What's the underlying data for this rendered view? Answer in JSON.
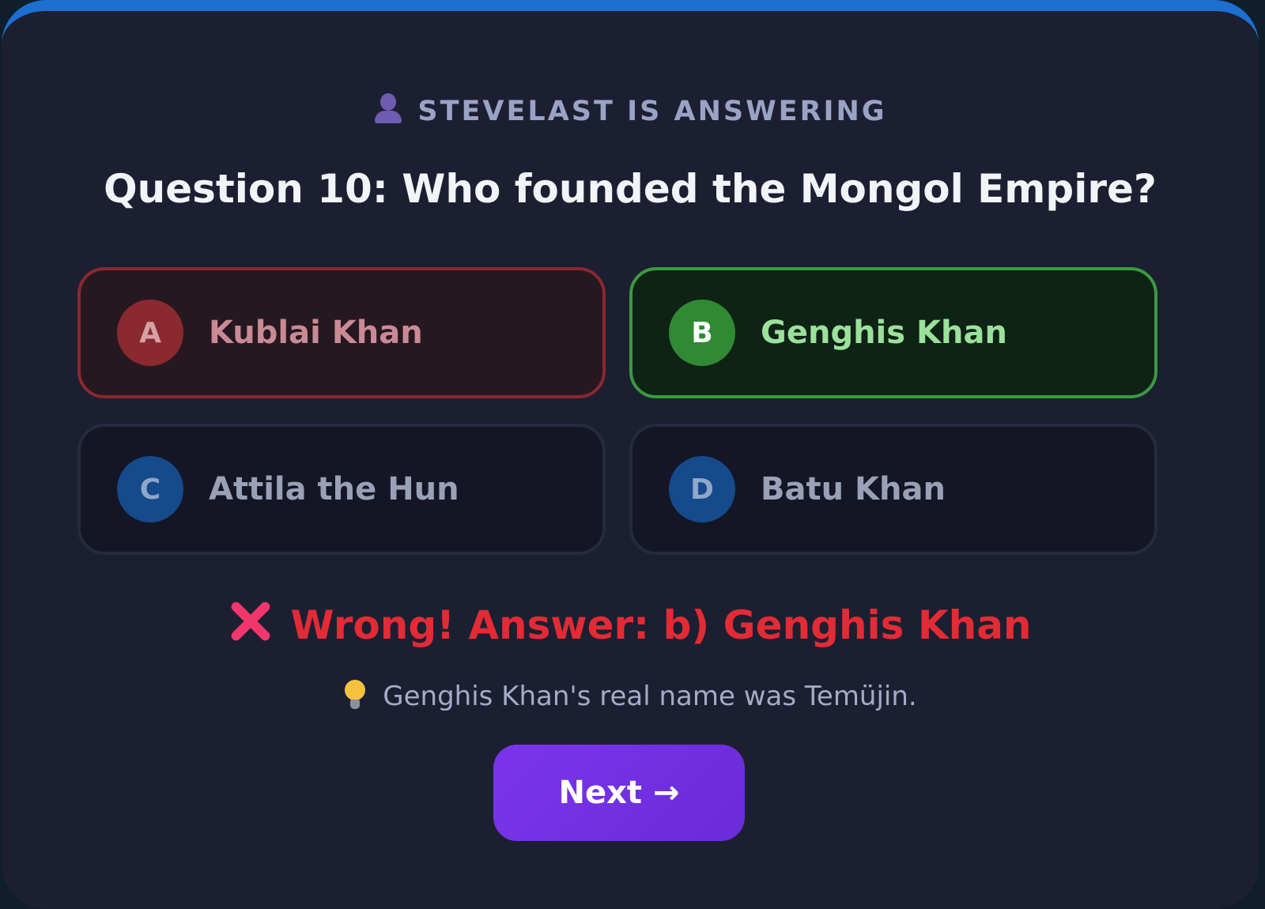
{
  "status": {
    "icon": "person-silhouette-icon",
    "text": "STEVELAST IS ANSWERING"
  },
  "question": {
    "text": "Question 10: Who founded the Mongol Empire?"
  },
  "options": [
    {
      "letter": "A",
      "label": "Kublai Khan",
      "state": "wrong-selected"
    },
    {
      "letter": "B",
      "label": "Genghis Khan",
      "state": "correct"
    },
    {
      "letter": "C",
      "label": "Attila the Hun",
      "state": "neutral"
    },
    {
      "letter": "D",
      "label": "Batu Khan",
      "state": "neutral"
    }
  ],
  "result": {
    "icon": "cross-mark-icon",
    "text": "Wrong! Answer: b) Genghis Khan"
  },
  "fact": {
    "icon": "light-bulb-icon",
    "text": "Genghis Khan's real name was Temüjin."
  },
  "next_button": {
    "label": "Next →"
  },
  "colors": {
    "accent": "#7b35ea",
    "correct": "#3b9a3f",
    "wrong": "#e32b35",
    "option_letter_blue": "#154a8c",
    "top_bar": "#1d6fd0"
  }
}
